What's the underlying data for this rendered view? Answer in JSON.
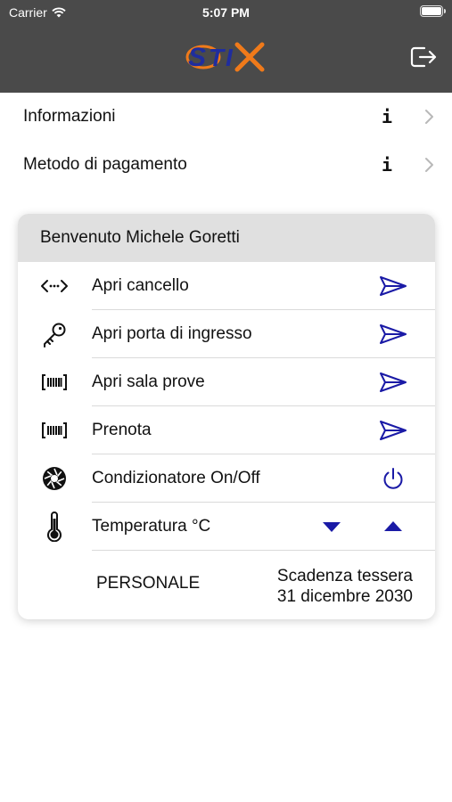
{
  "status_bar": {
    "carrier": "Carrier",
    "time": "5:07 PM"
  },
  "header": {
    "logo_icon": "stix-logo",
    "logout_icon": "logout-icon"
  },
  "menu": [
    {
      "label": "Informazioni",
      "info": "i"
    },
    {
      "label": "Metodo di pagamento",
      "info": "i"
    }
  ],
  "card": {
    "welcome": "Benvenuto Michele Goretti",
    "actions": [
      {
        "label": "Apri cancello",
        "icon": "gate-arrows-icon"
      },
      {
        "label": "Apri porta di ingresso",
        "icon": "key-icon"
      },
      {
        "label": "Apri sala prove",
        "icon": "barcode-icon"
      },
      {
        "label": "Prenota",
        "icon": "barcode-icon"
      },
      {
        "label": "Condizionatore On/Off",
        "icon": "fan-icon"
      },
      {
        "label": "Temperatura °C",
        "icon": "thermometer-icon"
      }
    ],
    "membership_type": "PERSONALE",
    "expiry_label": "Scadenza tessera",
    "expiry_date": "31 dicembre 2030"
  },
  "colors": {
    "header_bg": "#4a4a4a",
    "accent": "#1a1aa6",
    "card_header_bg": "#e0e0e0"
  }
}
